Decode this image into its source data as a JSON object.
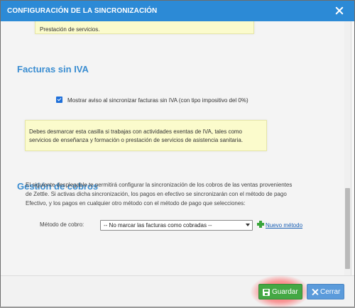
{
  "dialog": {
    "title": "CONFIGURACIÓN DE LA SINCRONIZACIÓN",
    "close_icon": "close-icon"
  },
  "tip_top": {
    "text": "Prestación de servicios."
  },
  "sections": {
    "facturas": {
      "title": "Facturas sin IVA",
      "checkbox_label": "Mostrar aviso al sincronizar facturas sin IVA (con tipo impositivo del 0%)",
      "checkbox_checked": true,
      "tip_line1": "Debes desmarcar esta casilla si trabajas con actividades exentas de IVA, tales como",
      "tip_line2": "servicios de enseñanza y formación o prestación de servicios de asistencia sanitaria."
    },
    "cobros": {
      "title": "Gestión de cobros",
      "desc_line1": "El siguiente desplegable te permitirá configurar la sincronización de los cobros de las ventas provenientes",
      "desc_line2": "de Zettle. Si activas dicha sincronización, los pagos en efectivo se sincronizarán con el método de pago",
      "desc_line3": "Efectivo, y los pagos en cualquier otro método con el método de pago que selecciones:",
      "method_label": "Método de cobro:",
      "method_selected": "-- No marcar las facturas como cobradas --",
      "new_method_link": "Nuevo método"
    }
  },
  "footer": {
    "save_label": "Guardar",
    "close_label": "Cerrar"
  },
  "colors": {
    "title_bar": "#2c8ad6",
    "section_title": "#3a8dd1",
    "save_button": "#44a844",
    "close_button": "#5b9bdb",
    "tip_background": "#fbfbcc",
    "highlight_glow": "#ff4040"
  }
}
